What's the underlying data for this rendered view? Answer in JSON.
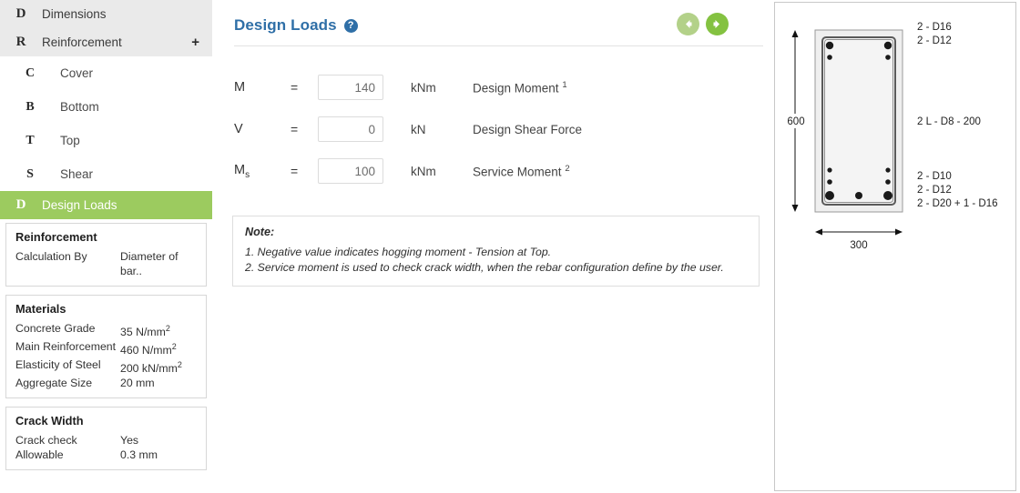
{
  "sidebar": {
    "nav": [
      {
        "letter": "D",
        "label": "Dimensions",
        "state": "shaded",
        "plus": ""
      },
      {
        "letter": "R",
        "label": "Reinforcement",
        "state": "shaded",
        "plus": "+"
      },
      {
        "letter": "C",
        "label": "Cover",
        "state": "sub",
        "plus": ""
      },
      {
        "letter": "B",
        "label": "Bottom",
        "state": "sub",
        "plus": ""
      },
      {
        "letter": "T",
        "label": "Top",
        "state": "sub",
        "plus": ""
      },
      {
        "letter": "S",
        "label": "Shear",
        "state": "sub",
        "plus": ""
      },
      {
        "letter": "D",
        "label": "Design Loads",
        "state": "active",
        "plus": ""
      }
    ],
    "cards": [
      {
        "title": "Reinforcement",
        "rows": [
          {
            "key": "Calculation By",
            "value": "Diameter of bar.."
          }
        ]
      },
      {
        "title": "Materials",
        "rows": [
          {
            "key": "Concrete Grade",
            "value": "35 N/mm",
            "sup": "2"
          },
          {
            "key": "Main Reinforcement",
            "value": "460 N/mm",
            "sup": "2"
          },
          {
            "key": "Elasticity of Steel",
            "value": "200 kN/mm",
            "sup": "2"
          },
          {
            "key": "Aggregate Size",
            "value": "20 mm",
            "sup": ""
          }
        ]
      },
      {
        "title": "Crack Width",
        "rows": [
          {
            "key": "Crack check",
            "value": "Yes",
            "sup": ""
          },
          {
            "key": "Allowable",
            "value": "0.3 mm",
            "sup": ""
          }
        ]
      }
    ]
  },
  "main": {
    "title": "Design Loads",
    "help_icon": "question-mark-icon",
    "prev_label": "previous-arrow-icon",
    "next_label": "next-arrow-icon",
    "rows": [
      {
        "symbol": "M",
        "sub": "",
        "eq": "=",
        "value": "140",
        "unit": "kNm",
        "desc": "Design Moment",
        "sup": "1"
      },
      {
        "symbol": "V",
        "sub": "",
        "eq": "=",
        "value": "0",
        "unit": "kN",
        "desc": "Design Shear Force",
        "sup": ""
      },
      {
        "symbol": "M",
        "sub": "s",
        "eq": "=",
        "value": "100",
        "unit": "kNm",
        "desc": "Service Moment",
        "sup": "2"
      }
    ],
    "note": {
      "title": "Note:",
      "lines": [
        "1. Negative value indicates hogging moment - Tension at Top.",
        "2. Service moment is used to check crack width, when the rebar configuration define by the user."
      ]
    }
  },
  "diagram": {
    "width_label": "300",
    "height_label": "600",
    "top_labels": [
      "2 - D16",
      "2 - D12"
    ],
    "mid_label": "2 L - D8 - 200",
    "bottom_labels": [
      "2 - D10",
      "2 - D12",
      "2 - D20 + 1 - D16"
    ],
    "colors": {
      "concrete": "#efefef",
      "outline": "#6d6d6d",
      "rebar": "#1a1a1a"
    }
  }
}
